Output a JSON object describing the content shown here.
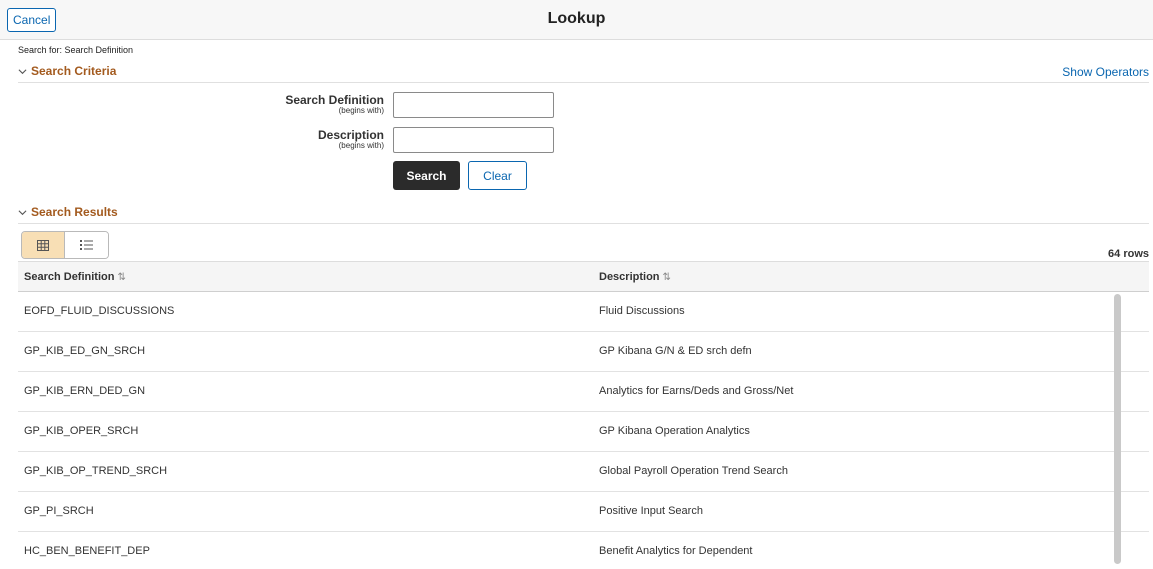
{
  "header": {
    "cancel_label": "Cancel",
    "title": "Lookup"
  },
  "search_for": "Search for: Search Definition",
  "criteria": {
    "heading": "Search Criteria",
    "show_operators": "Show Operators",
    "fields": [
      {
        "label": "Search Definition",
        "sublabel": "(begins with)",
        "value": ""
      },
      {
        "label": "Description",
        "sublabel": "(begins with)",
        "value": ""
      }
    ],
    "search_label": "Search",
    "clear_label": "Clear"
  },
  "results": {
    "heading": "Search Results",
    "view_icons": [
      "grid-view-icon",
      "list-view-icon"
    ],
    "row_count": "64 rows",
    "columns": [
      "Search Definition",
      "Description"
    ],
    "rows": [
      [
        "EOFD_FLUID_DISCUSSIONS",
        "Fluid Discussions"
      ],
      [
        "GP_KIB_ED_GN_SRCH",
        "GP Kibana G/N & ED srch defn"
      ],
      [
        "GP_KIB_ERN_DED_GN",
        "Analytics for Earns/Deds and Gross/Net"
      ],
      [
        "GP_KIB_OPER_SRCH",
        "GP Kibana Operation Analytics"
      ],
      [
        "GP_KIB_OP_TREND_SRCH",
        "Global Payroll Operation Trend Search"
      ],
      [
        "GP_PI_SRCH",
        "Positive Input Search"
      ],
      [
        "HC_BEN_BENEFIT_DEP",
        "Benefit Analytics for Dependent"
      ]
    ]
  },
  "colors": {
    "accent": "#0a66b0",
    "section_heading": "#a35a1e",
    "active_toggle": "#f8dfb5"
  }
}
